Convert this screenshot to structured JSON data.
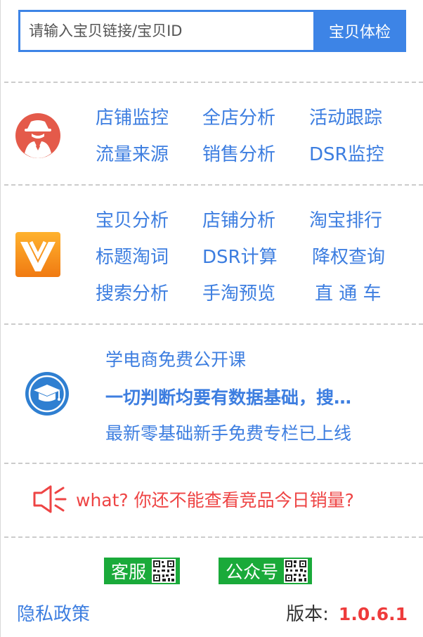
{
  "search": {
    "placeholder": "请输入宝贝链接/宝贝ID",
    "button_label": "宝贝体检"
  },
  "shop_section": {
    "icon": "spy-agent-icon",
    "links": [
      "店铺监控",
      "全店分析",
      "活动跟踪",
      "流量来源",
      "销售分析",
      "DSR监控"
    ]
  },
  "item_section": {
    "icon": "checkmark-logo-icon",
    "links": [
      "宝贝分析",
      "店铺分析",
      "淘宝排行",
      "标题淘词",
      "DSR计算",
      "降权查询",
      "搜索分析",
      "手淘预览",
      "直 通 车"
    ]
  },
  "course_section": {
    "icon": "graduation-cap-icon",
    "items": [
      "学电商免费公开课",
      "一切判断均要有数据基础，搜…",
      "最新零基础新手免费专栏已上线"
    ]
  },
  "promo": {
    "icon": "megaphone-icon",
    "text": "what? 你还不能查看竞品今日销量?"
  },
  "footer": {
    "service_label": "客服",
    "official_label": "公众号",
    "privacy_label": "隐私政策",
    "version_label": "版本:",
    "version_number": "1.0.6.1"
  },
  "colors": {
    "primary_blue": "#3d84e6",
    "link_blue": "#3d7ee0",
    "alert_red": "#ee4444",
    "qr_green": "#1aaa3a"
  }
}
